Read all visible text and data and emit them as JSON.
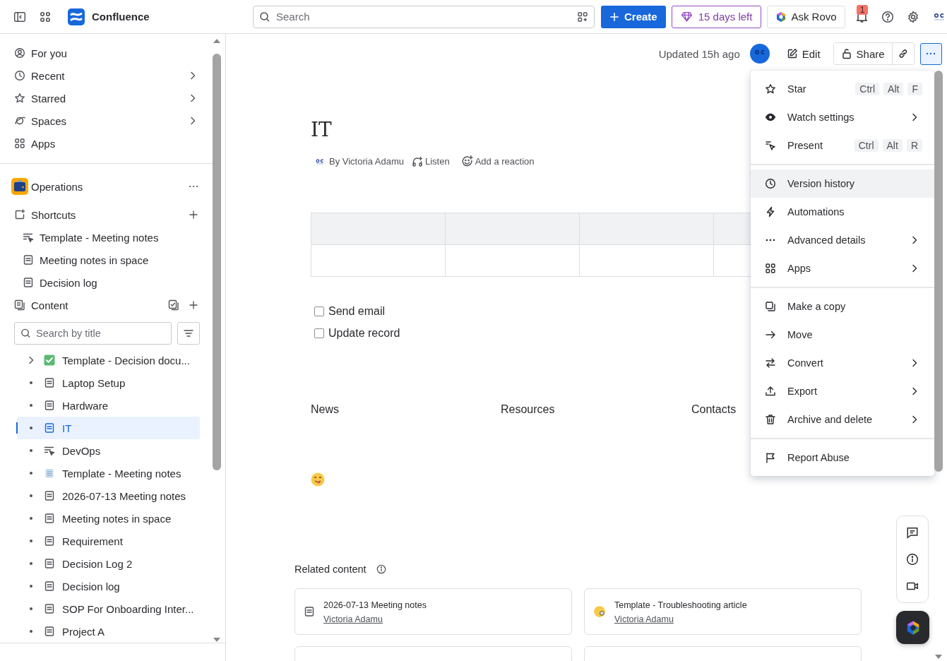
{
  "topbar": {
    "product": "Confluence",
    "search_placeholder": "Search",
    "create": "Create",
    "trial": "15 days left",
    "ask_rovo": "Ask Rovo",
    "notification_count": "1"
  },
  "sidebar": {
    "nav": [
      {
        "label": "For you",
        "expandable": false
      },
      {
        "label": "Recent",
        "expandable": true
      },
      {
        "label": "Starred",
        "expandable": true
      },
      {
        "label": "Spaces",
        "expandable": true
      },
      {
        "label": "Apps",
        "expandable": false
      }
    ],
    "space": {
      "name": "Operations"
    },
    "shortcuts": {
      "title": "Shortcuts",
      "items": [
        {
          "label": "Template - Meeting notes",
          "kind": "template"
        },
        {
          "label": "Meeting notes in space",
          "kind": "page"
        },
        {
          "label": "Decision log",
          "kind": "page"
        }
      ]
    },
    "content": {
      "title": "Content",
      "search_placeholder": "Search by title",
      "tree": [
        {
          "label": "Template - Decision docu...",
          "kind": "check",
          "expandable": true,
          "selected": false
        },
        {
          "label": "Laptop Setup",
          "kind": "page",
          "expandable": false,
          "selected": false
        },
        {
          "label": "Hardware",
          "kind": "page",
          "expandable": false,
          "selected": false
        },
        {
          "label": "IT",
          "kind": "page",
          "expandable": false,
          "selected": true
        },
        {
          "label": "DevOps",
          "kind": "template",
          "expandable": false,
          "selected": false
        },
        {
          "label": "Template - Meeting notes",
          "kind": "notepad",
          "expandable": false,
          "selected": false
        },
        {
          "label": "2026-07-13 Meeting notes",
          "kind": "page",
          "expandable": false,
          "selected": false
        },
        {
          "label": "Meeting notes in space",
          "kind": "page",
          "expandable": false,
          "selected": false
        },
        {
          "label": "Requirement",
          "kind": "page",
          "expandable": false,
          "selected": false
        },
        {
          "label": "Decision Log 2",
          "kind": "page",
          "expandable": false,
          "selected": false
        },
        {
          "label": "Decision log",
          "kind": "page",
          "expandable": false,
          "selected": false
        },
        {
          "label": "SOP For Onboarding Inter...",
          "kind": "page",
          "expandable": false,
          "selected": false
        },
        {
          "label": "Project A",
          "kind": "page",
          "expandable": false,
          "selected": false
        }
      ]
    }
  },
  "page": {
    "updated": "Updated 15h ago",
    "edit": "Edit",
    "share": "Share",
    "title": "IT",
    "byline": "By Victoria Adamu",
    "listen": "Listen",
    "reaction": "Add a reaction",
    "tasks": [
      {
        "label": "Send email",
        "checked": false
      },
      {
        "label": "Update record",
        "checked": false
      }
    ],
    "columns": [
      "News",
      "Resources",
      "Contacts"
    ]
  },
  "related": {
    "title": "Related content",
    "cards": [
      {
        "title": "2026-07-13 Meeting notes",
        "author": "Victoria Adamu",
        "kind": "page"
      },
      {
        "title": "Template - Troubleshooting article",
        "author": "Victoria Adamu",
        "kind": "emoji"
      }
    ]
  },
  "menu": {
    "groups": [
      [
        {
          "label": "Star",
          "shortcut": [
            "Ctrl",
            "Alt",
            "F"
          ],
          "submenu": false,
          "highlighted": false
        },
        {
          "label": "Watch settings",
          "submenu": true,
          "highlighted": false
        },
        {
          "label": "Present",
          "shortcut": [
            "Ctrl",
            "Alt",
            "R"
          ],
          "submenu": false,
          "highlighted": false
        }
      ],
      [
        {
          "label": "Version history",
          "submenu": false,
          "highlighted": true
        },
        {
          "label": "Automations",
          "submenu": false,
          "highlighted": false
        },
        {
          "label": "Advanced details",
          "submenu": true,
          "highlighted": false
        },
        {
          "label": "Apps",
          "submenu": true,
          "highlighted": false
        }
      ],
      [
        {
          "label": "Make a copy",
          "submenu": false,
          "highlighted": false
        },
        {
          "label": "Move",
          "submenu": false,
          "highlighted": false
        },
        {
          "label": "Convert",
          "submenu": true,
          "highlighted": false
        },
        {
          "label": "Export",
          "submenu": true,
          "highlighted": false
        },
        {
          "label": "Archive and delete",
          "submenu": true,
          "highlighted": false
        }
      ],
      [
        {
          "label": "Report Abuse",
          "submenu": false,
          "highlighted": false
        }
      ]
    ]
  }
}
